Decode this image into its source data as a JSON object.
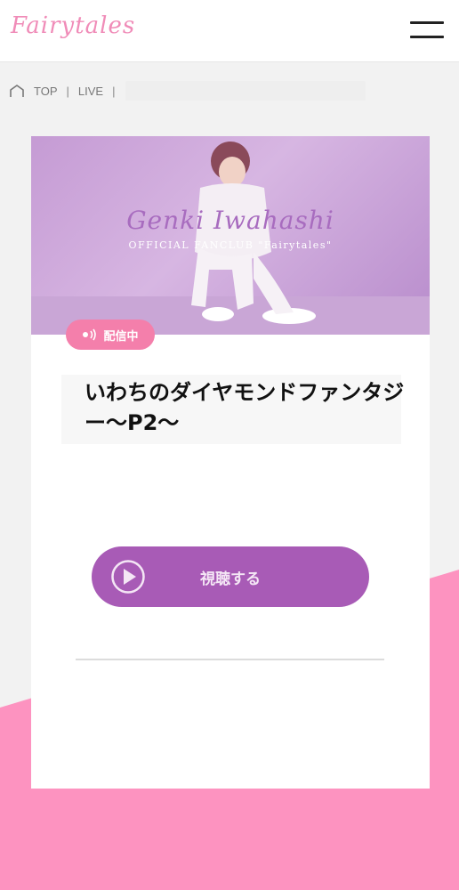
{
  "header": {
    "logo_text": "Fairytales",
    "menu_icon": "hamburger-menu-icon"
  },
  "breadcrumb": {
    "home_icon": "home-icon",
    "items": [
      "TOP",
      "LIVE"
    ],
    "separator": "|"
  },
  "card": {
    "banner": {
      "artist_name": "Genki Iwahashi",
      "subtitle": "OFFICIAL FANCLUB \"Fairytales\""
    },
    "status_badge": {
      "label": "配信中",
      "icon": "broadcast-icon"
    },
    "title": "いわちのダイヤモンドファンタジー～P2～",
    "watch_button": {
      "label": "視聴する",
      "icon": "play-circle-icon"
    }
  },
  "colors": {
    "pink_background": "#fd93c0",
    "accent_pink": "#f47fab",
    "button_purple": "#a85bb6",
    "logo_pink": "#f08cb8"
  }
}
